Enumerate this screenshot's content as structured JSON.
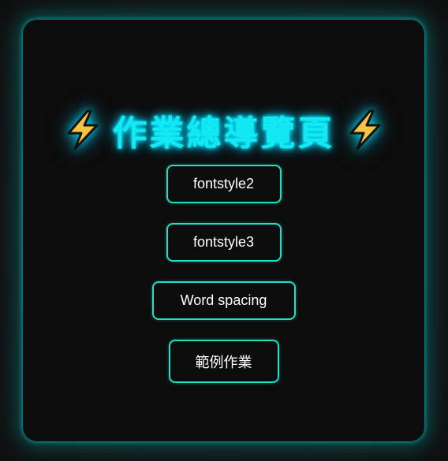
{
  "header": {
    "title": "作業總導覽頁",
    "left_icon": "lightning-bolt-icon",
    "right_icon": "lightning-bolt-icon"
  },
  "links": [
    {
      "label": "fontstyle2"
    },
    {
      "label": "fontstyle3"
    },
    {
      "label": "Word spacing"
    },
    {
      "label": "範例作業"
    }
  ],
  "colors": {
    "background": "#141516",
    "card": "#0c0c0c",
    "title_glow": "#16e8f2",
    "button_border": "#21e0c8",
    "button_text": "#ffffff",
    "bolt_fill": "#f6c343"
  }
}
